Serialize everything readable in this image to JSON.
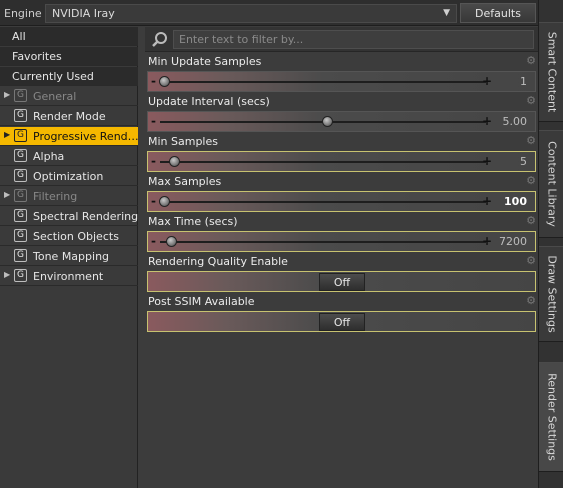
{
  "engine": {
    "label": "Engine :",
    "value": "NVIDIA Iray",
    "defaults_label": "Defaults"
  },
  "categories": {
    "top": [
      "All",
      "Favorites",
      "Currently Used"
    ],
    "groups": [
      {
        "label": "General",
        "expandable": true,
        "disabled": true,
        "selected": false
      },
      {
        "label": "Render Mode",
        "expandable": false,
        "disabled": false,
        "selected": false
      },
      {
        "label": "Progressive Rend…",
        "expandable": true,
        "disabled": false,
        "selected": true
      },
      {
        "label": "Alpha",
        "expandable": false,
        "disabled": false,
        "selected": false
      },
      {
        "label": "Optimization",
        "expandable": false,
        "disabled": false,
        "selected": false
      },
      {
        "label": "Filtering",
        "expandable": true,
        "disabled": true,
        "selected": false
      },
      {
        "label": "Spectral Rendering",
        "expandable": false,
        "disabled": false,
        "selected": false
      },
      {
        "label": "Section Objects",
        "expandable": false,
        "disabled": false,
        "selected": false
      },
      {
        "label": "Tone Mapping",
        "expandable": false,
        "disabled": false,
        "selected": false
      },
      {
        "label": "Environment",
        "expandable": true,
        "disabled": false,
        "selected": false
      }
    ],
    "group_icon": "G"
  },
  "filter": {
    "placeholder": "Enter text to filter by..."
  },
  "properties": [
    {
      "title": "Min Update Samples",
      "value": "1",
      "level": 0.0,
      "highlight": false,
      "bold": false
    },
    {
      "title": "Update Interval (secs)",
      "value": "5.00",
      "level": 0.5,
      "highlight": false,
      "bold": false
    },
    {
      "title": "Min Samples",
      "value": "5",
      "level": 0.03,
      "highlight": true,
      "bold": false
    },
    {
      "title": "Max Samples",
      "value": "100",
      "level": 0.0,
      "highlight": true,
      "bold": true
    },
    {
      "title": "Max Time (secs)",
      "value": "7200",
      "level": 0.02,
      "highlight": true,
      "bold": false
    }
  ],
  "toggles": [
    {
      "title": "Rendering Quality Enable",
      "value": "Off"
    },
    {
      "title": "Post SSIM Available",
      "value": "Off"
    }
  ],
  "side_tabs": [
    "Smart Content",
    "Content Library",
    "Draw Settings",
    "Render Settings"
  ],
  "active_side_tab": "Render Settings",
  "colors": {
    "selected": "#f5b800",
    "highlight_border": "#c7c270"
  }
}
